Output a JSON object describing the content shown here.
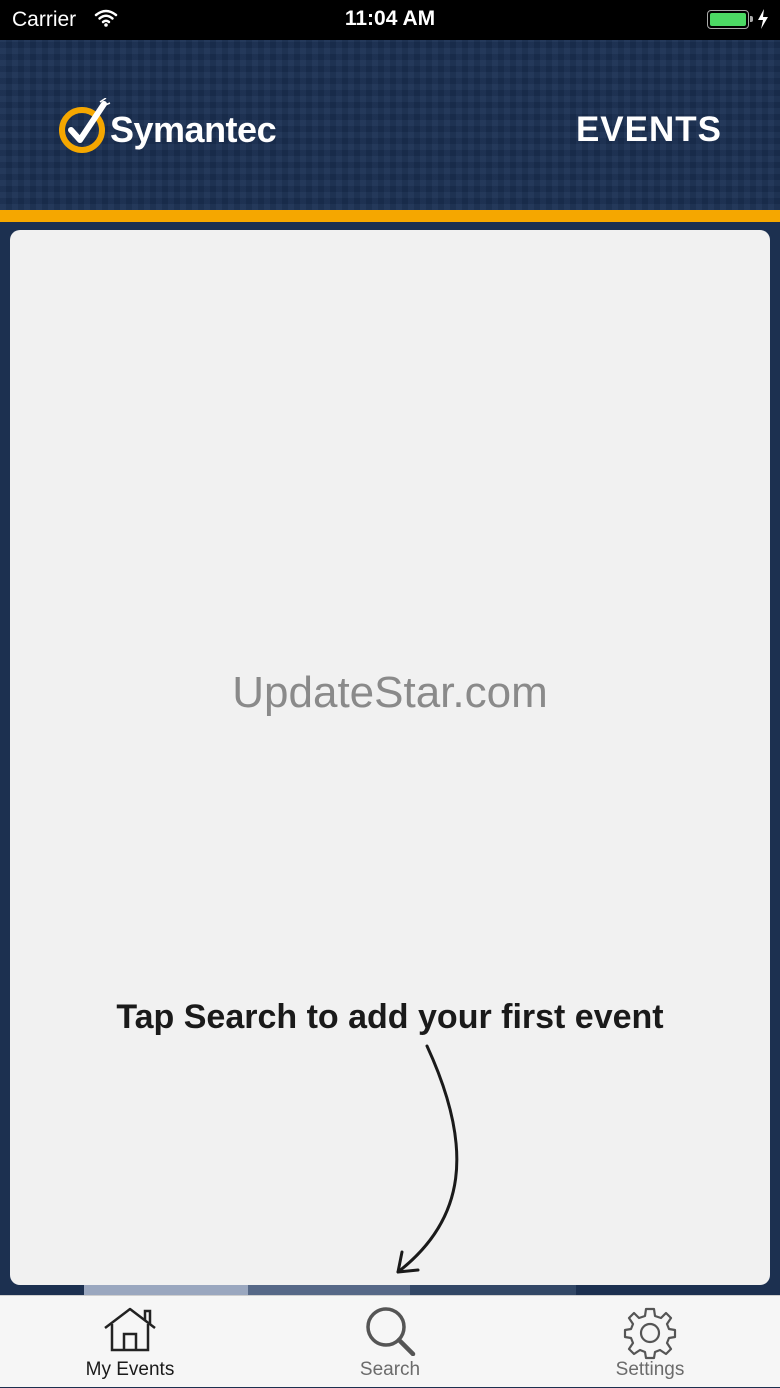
{
  "status_bar": {
    "carrier": "Carrier",
    "time": "11:04 AM",
    "battery_color": "#4cd964"
  },
  "header": {
    "logo_text": "Symantec",
    "logo_trademark": "™",
    "title": "EVENTS",
    "accent_color": "#f5a700",
    "background_color": "#1a2f52"
  },
  "content": {
    "watermark": "UpdateStar.com",
    "hint": "Tap Search to add your first event"
  },
  "tab_bar": {
    "tabs": [
      {
        "label": "My Events",
        "icon": "home-icon",
        "active": true
      },
      {
        "label": "Search",
        "icon": "search-icon",
        "active": false
      },
      {
        "label": "Settings",
        "icon": "gear-icon",
        "active": false
      }
    ]
  }
}
